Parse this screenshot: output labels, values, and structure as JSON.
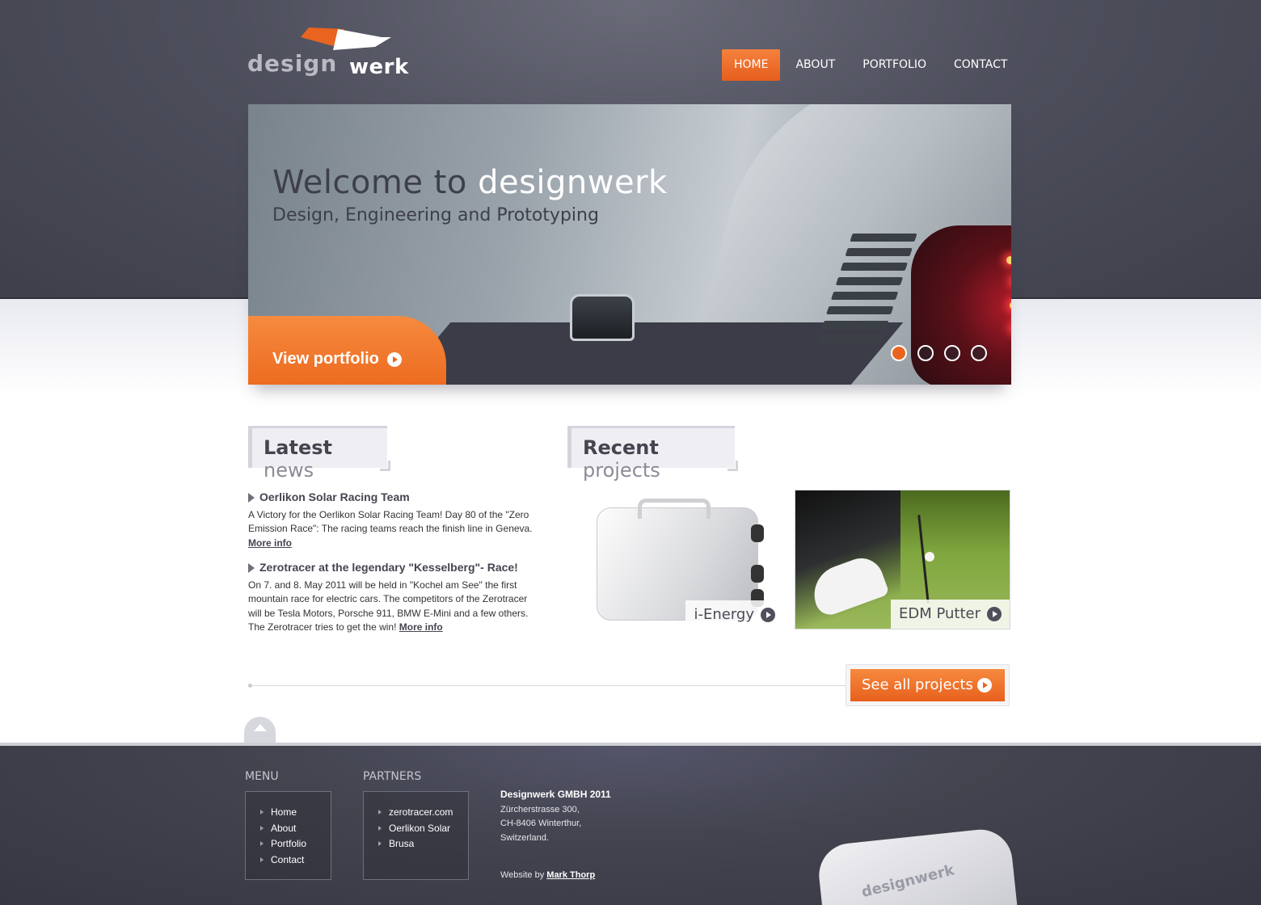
{
  "logo": {
    "word_a": "design",
    "word_b": "werk",
    "wing_color": "#e8641f"
  },
  "nav": {
    "items": [
      {
        "label": "HOME",
        "active": true
      },
      {
        "label": "ABOUT",
        "active": false
      },
      {
        "label": "PORTFOLIO",
        "active": false
      },
      {
        "label": "CONTACT",
        "active": false
      }
    ]
  },
  "hero": {
    "title_lead": "Welcome to",
    "title_accent": "designwerk",
    "subtitle": "Design, Engineering and Prototyping",
    "cta_label": "View portfolio",
    "slide_count": 4,
    "active_slide": 1,
    "accent_color": "#e8641f"
  },
  "news": {
    "heading_bold": "Latest",
    "heading_light": "news",
    "items": [
      {
        "title": "Oerlikon Solar Racing Team",
        "body": "A Victory for the Oerlikon Solar Racing Team! Day 80 of the \"Zero Emission Race\": The racing teams reach the finish line in Geneva.",
        "more": "More info"
      },
      {
        "title": "Zerotracer at the legendary \"Kesselberg\"- Race!",
        "body": "On 7. and 8. May 2011 will be held in \"Kochel am See\" the first mountain race for electric cars. The competitors of the Zerotracer will be Tesla Motors, Porsche 911, BMW E-Mini and a few others. The Zerotracer tries to get the win!",
        "more": "More info"
      }
    ]
  },
  "projects": {
    "heading_bold": "Recent",
    "heading_light": "projects",
    "items": [
      {
        "label": "i-Energy",
        "icon": "play-icon"
      },
      {
        "label": "EDM Putter",
        "icon": "play-icon"
      }
    ],
    "see_all_label": "See all projects"
  },
  "footer": {
    "menu_title": "MENU",
    "menu_items": [
      "Home",
      "About",
      "Portfolio",
      "Contact"
    ],
    "partners_title": "PARTNERS",
    "partner_items": [
      "zerotracer.com",
      "Oerlikon Solar",
      "Brusa"
    ],
    "company": "Designwerk GMBH 2011",
    "address_lines": [
      "Zürcherstrasse 300,",
      "CH-8406 Winterthur,",
      "Switzerland."
    ],
    "credit_prefix": "Website by",
    "credit_name": "Mark Thorp",
    "badge_text": "designwerk"
  }
}
